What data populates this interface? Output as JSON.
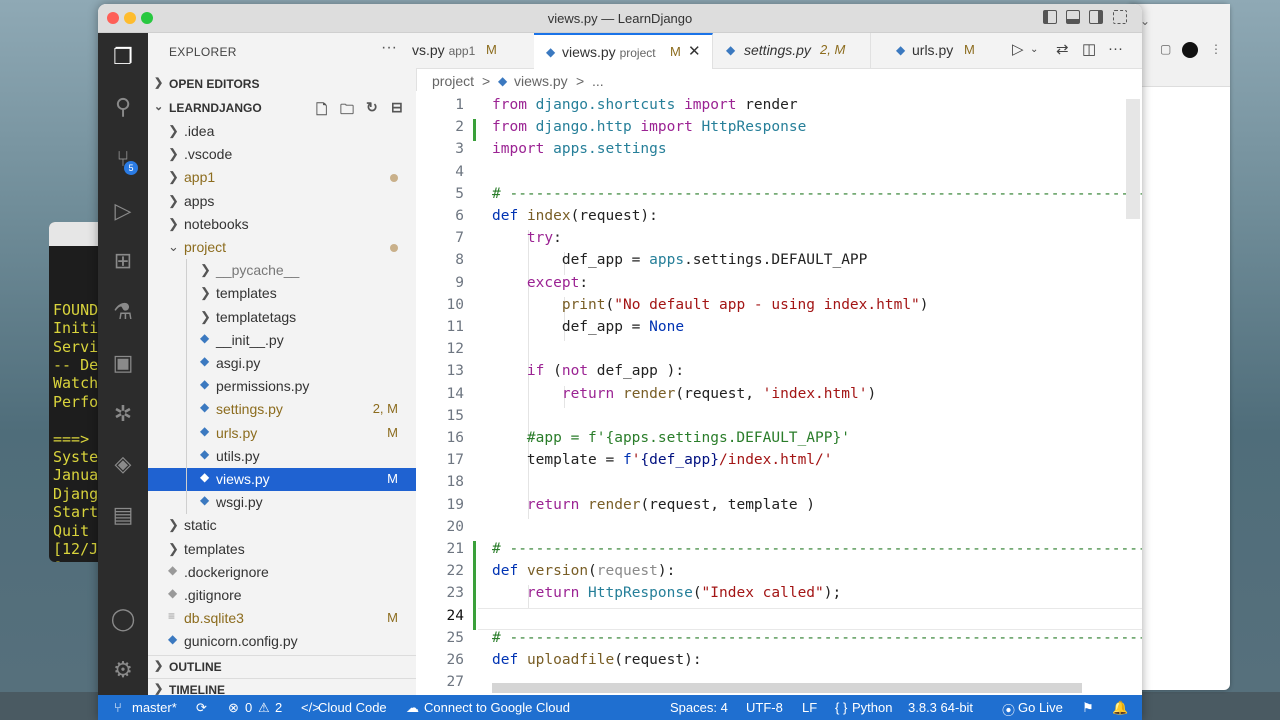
{
  "window": {
    "title": "views.py — LearnDjango"
  },
  "terminal_lines": [
    "",
    "",
    "FOUND",
    "Initi",
    "Servi",
    "-- De",
    "Watch",
    "Perfo",
    "",
    "===>",
    "Syste",
    "Janua",
    "Djang",
    "Start",
    "Quit",
    "[12/J",
    "[12/J"
  ],
  "sidebar": {
    "title": "EXPLORER",
    "more": "···",
    "open_editors": "OPEN EDITORS",
    "project": "LEARNDJANGO",
    "outline": "OUTLINE",
    "timeline": "TIMELINE",
    "items": [
      {
        "name": ".idea",
        "decoration": ""
      },
      {
        "name": ".vscode",
        "decoration": ""
      },
      {
        "name": "app1",
        "decoration": ""
      },
      {
        "name": "apps",
        "decoration": ""
      },
      {
        "name": "notebooks",
        "decoration": ""
      },
      {
        "name": "project",
        "decoration": ""
      },
      {
        "name": "__pycache__",
        "decoration": ""
      },
      {
        "name": "templates",
        "decoration": ""
      },
      {
        "name": "templatetags",
        "decoration": ""
      },
      {
        "name": "__init__.py",
        "decoration": ""
      },
      {
        "name": "asgi.py",
        "decoration": ""
      },
      {
        "name": "permissions.py",
        "decoration": ""
      },
      {
        "name": "settings.py",
        "decoration": "2, M"
      },
      {
        "name": "urls.py",
        "decoration": "M"
      },
      {
        "name": "utils.py",
        "decoration": ""
      },
      {
        "name": "views.py",
        "decoration": "M"
      },
      {
        "name": "wsgi.py",
        "decoration": ""
      },
      {
        "name": "static",
        "decoration": ""
      },
      {
        "name": "templates",
        "decoration": ""
      },
      {
        "name": ".dockerignore",
        "decoration": ""
      },
      {
        "name": ".gitignore",
        "decoration": ""
      },
      {
        "name": "db.sqlite3",
        "decoration": "M"
      },
      {
        "name": "gunicorn.config.py",
        "decoration": ""
      }
    ]
  },
  "tabs": [
    {
      "name": "vs.py",
      "dir": "app1",
      "mod": "M"
    },
    {
      "name": "views.py",
      "dir": "project",
      "mod": "M"
    },
    {
      "name": "settings.py",
      "dir": "",
      "mod": "2, M"
    },
    {
      "name": "urls.py",
      "dir": "",
      "mod": "M"
    }
  ],
  "breadcrumb": {
    "folder": "project",
    "sep": ">",
    "file": "views.py",
    "sep2": ">",
    "more": "..."
  },
  "line_numbers": [
    "1",
    "2",
    "3",
    "4",
    "5",
    "6",
    "7",
    "8",
    "9",
    "10",
    "11",
    "12",
    "13",
    "14",
    "15",
    "16",
    "17",
    "18",
    "19",
    "20",
    "21",
    "22",
    "23",
    "24",
    "25",
    "26",
    "27"
  ],
  "code": {
    "l1": [
      "from",
      " django.shortcuts ",
      "import",
      " render"
    ],
    "l2": [
      "from",
      " django.http ",
      "import",
      " HttpResponse"
    ],
    "l3": [
      "import",
      " apps.settings"
    ],
    "l5": "# -------------------------------------------------------------------------------------------------------",
    "l6": [
      "def",
      " ",
      "index",
      "(request):"
    ],
    "l7": [
      "    ",
      "try",
      ":"
    ],
    "l8": [
      "        def_app = ",
      "apps",
      ".settings.DEFAULT_APP"
    ],
    "l9": [
      "    ",
      "except",
      ":"
    ],
    "l10": [
      "        ",
      "print",
      "(",
      "\"No default app - using index.html\"",
      ")"
    ],
    "l11": [
      "        def_app = ",
      "None"
    ],
    "l13": [
      "    ",
      "if",
      " (",
      "not",
      " def_app ):"
    ],
    "l14": [
      "        ",
      "return",
      " ",
      "render",
      "(request, ",
      "'index.html'",
      ")"
    ],
    "l16": "    #app = f'{apps.settings.DEFAULT_APP}'",
    "l17": [
      "    template = ",
      "f",
      "'",
      "{def_app}",
      "/index.html/'"
    ],
    "l19": [
      "    ",
      "return",
      " ",
      "render",
      "(request, template )"
    ],
    "l21": "# -------------------------------------------------------------------------------------------------------",
    "l22": [
      "def",
      " ",
      "version",
      "(",
      "request",
      "):"
    ],
    "l23": [
      "    ",
      "return",
      " ",
      "HttpResponse",
      "(",
      "\"Index called\"",
      ");"
    ],
    "l25": "# -------------------------------------------------------------------------------------------------------",
    "l26": [
      "def",
      " ",
      "uploadfile",
      "(request):"
    ]
  },
  "statusbar": {
    "branch": "master*",
    "errors": "0",
    "warnings": "2",
    "cloud_code": "Cloud Code",
    "connect": "Connect to Google Cloud",
    "spaces": "Spaces: 4",
    "encoding": "UTF-8",
    "eol": "LF",
    "language": "Python",
    "interpreter": "3.8.3 64-bit",
    "golive": "Go Live"
  },
  "badges": {
    "source_control": "5"
  },
  "colors": {
    "accent": "#1f6fd0",
    "selection": "#1f62d1",
    "modified": "#8c6c1e"
  }
}
